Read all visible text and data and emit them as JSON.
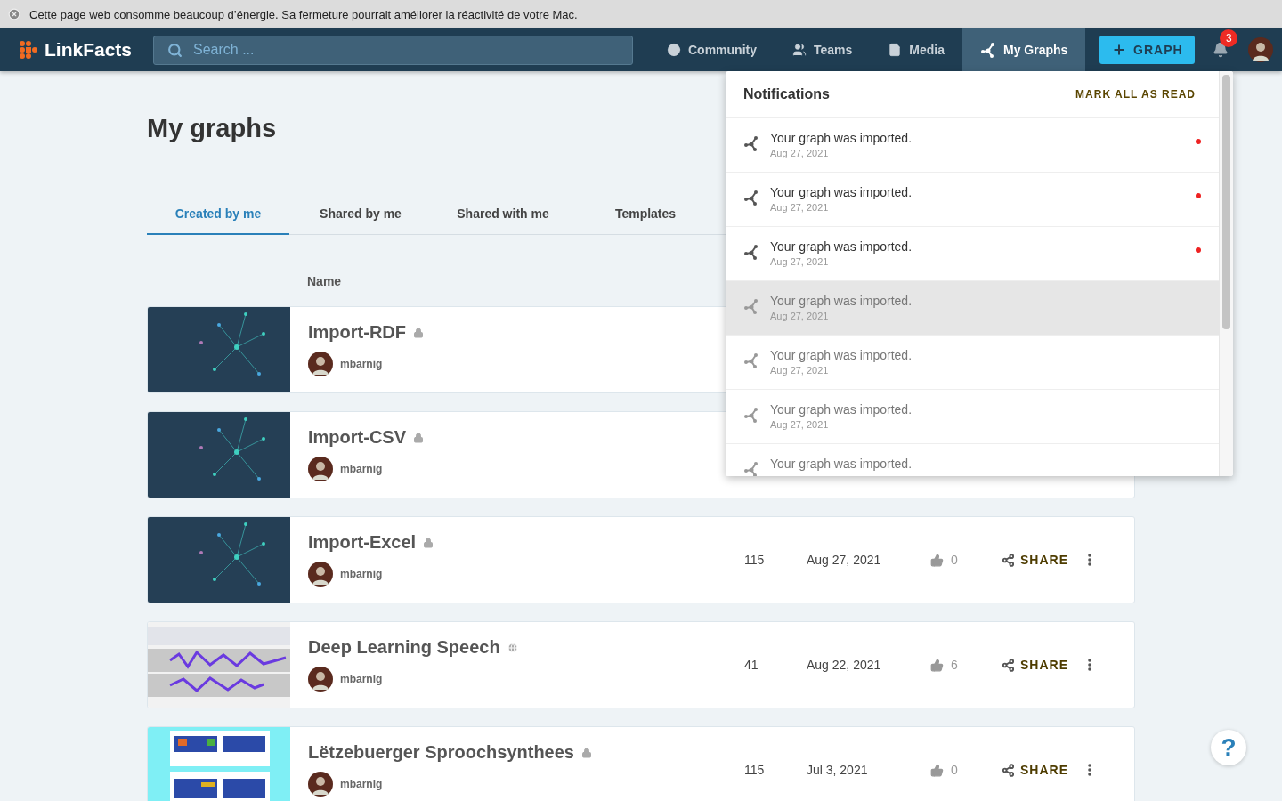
{
  "banner": {
    "text": "Cette page web consomme beaucoup d’énergie. Sa fermeture pourrait améliorer la réactivité de votre Mac."
  },
  "nav": {
    "logo": "LinkFacts",
    "search": {
      "placeholder": "Search ..."
    },
    "items": [
      {
        "label": "Community",
        "selected": false
      },
      {
        "label": "Teams",
        "selected": false
      },
      {
        "label": "Media",
        "selected": false
      },
      {
        "label": "My Graphs",
        "selected": true
      }
    ],
    "new_button": "GRAPH",
    "notification_count": "3"
  },
  "page": {
    "title": "My graphs",
    "tabs": [
      {
        "label": "Created by me",
        "selected": true
      },
      {
        "label": "Shared by me",
        "selected": false
      },
      {
        "label": "Shared with me",
        "selected": false
      },
      {
        "label": "Templates",
        "selected": false
      }
    ],
    "columns": [
      "Name"
    ],
    "graphs": [
      {
        "title": "Import-RDF",
        "locked": true,
        "owner": "mbarnig",
        "kind": "network"
      },
      {
        "title": "Import-CSV",
        "locked": true,
        "owner": "mbarnig",
        "kind": "network"
      },
      {
        "title": "Import-Excel",
        "locked": true,
        "owner": "mbarnig",
        "kind": "network",
        "count": "115",
        "date": "Aug 27, 2021",
        "likes": "0",
        "share": "SHARE"
      },
      {
        "title": "Deep Learning Speech",
        "locked": false,
        "owner": "mbarnig",
        "kind": "waveform",
        "count": "41",
        "date": "Aug 22, 2021",
        "likes": "6",
        "share": "SHARE"
      },
      {
        "title": "Lëtzebuerger Sproochsynthees",
        "locked": true,
        "owner": "mbarnig",
        "kind": "diagram",
        "count": "115",
        "date": "Jul 3, 2021",
        "likes": "0",
        "share": "SHARE"
      }
    ]
  },
  "notifications": {
    "title": "Notifications",
    "mark_all": "MARK ALL AS READ",
    "items": [
      {
        "text": "Your graph was imported.",
        "date": "Aug 27, 2021",
        "unread": true,
        "selected": false
      },
      {
        "text": "Your graph was imported.",
        "date": "Aug 27, 2021",
        "unread": true,
        "selected": false
      },
      {
        "text": "Your graph was imported.",
        "date": "Aug 27, 2021",
        "unread": true,
        "selected": false
      },
      {
        "text": "Your graph was imported.",
        "date": "Aug 27, 2021",
        "unread": false,
        "selected": true
      },
      {
        "text": "Your graph was imported.",
        "date": "Aug 27, 2021",
        "unread": false,
        "selected": false
      },
      {
        "text": "Your graph was imported.",
        "date": "Aug 27, 2021",
        "unread": false,
        "selected": false
      },
      {
        "text": "Your graph was imported.",
        "unread": false,
        "selected": false
      }
    ]
  },
  "help": "?"
}
